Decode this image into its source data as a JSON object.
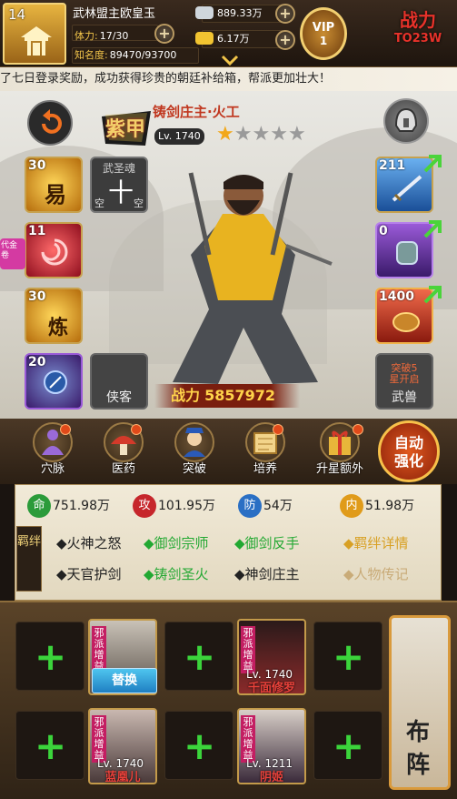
{
  "player": {
    "level": "14",
    "name": "武林盟主欧皇玉",
    "stamina_label": "体力:",
    "stamina": "17/30",
    "fame_label": "知名度:",
    "fame": "89470/93700"
  },
  "currency": {
    "silver": "889.33万",
    "gold": "6.17万"
  },
  "vip": {
    "label": "VIP",
    "level": "1"
  },
  "logo": {
    "text": "战力",
    "sub": "TO23W"
  },
  "marquee": "了七日登录奖励，成功获得珍贵的朝廷补给箱，帮派更加壮大！",
  "hero": {
    "title_badge": "紫甲",
    "name": "铸剑庄主·火工",
    "level": "Lv. 1740",
    "stars_filled": 1,
    "stars_total": 5,
    "power_label": "战力",
    "power": "5857972"
  },
  "left_slots": [
    {
      "num": "30",
      "glyph": "易",
      "color": "#e8a51e"
    },
    {
      "num": "",
      "glyph": "十",
      "top": "武圣魂",
      "corner_l": "空",
      "corner_r": "空",
      "color": "#555"
    },
    {
      "num": "11",
      "glyph": "",
      "color": "#d0283c"
    },
    {
      "num": "30",
      "glyph": "炼",
      "color": "#e8a51e"
    },
    {
      "num": "20",
      "glyph": "",
      "color": "#8a3ac4"
    },
    {
      "num": "",
      "glyph": "",
      "cap": "侠客",
      "color": "#555"
    }
  ],
  "side_tag": "代金卷",
  "right_slots": [
    {
      "num": "211",
      "color": "#3a79c9"
    },
    {
      "num": "0",
      "color": "#8a3ac4"
    },
    {
      "num": "1400",
      "color": "#d0283c"
    },
    {
      "num": "",
      "top": "突破5",
      "top2": "星开启",
      "cap": "武兽",
      "color": "#555"
    }
  ],
  "actions": [
    {
      "label": "穴脉"
    },
    {
      "label": "医药"
    },
    {
      "label": "突破"
    },
    {
      "label": "培养"
    },
    {
      "label": "升星额外"
    }
  ],
  "auto_button": {
    "line1": "自动",
    "line2": "强化"
  },
  "stats": [
    {
      "badge": "命",
      "value": "751.98万",
      "color": "#2b9b3a"
    },
    {
      "badge": "攻",
      "value": "101.95万",
      "color": "#c6262b"
    },
    {
      "badge": "防",
      "value": "54万",
      "color": "#2a6fc4"
    },
    {
      "badge": "内",
      "value": "51.98万",
      "color": "#e09b1a"
    }
  ],
  "bond_title": "羁绊",
  "bonds": [
    {
      "text": "◆火神之怒",
      "active": false
    },
    {
      "text": "◆御剑宗师",
      "active": true
    },
    {
      "text": "◆御剑反手",
      "active": true
    },
    {
      "text": "◆天官护剑",
      "active": false
    },
    {
      "text": "◆铸剑圣火",
      "active": true
    },
    {
      "text": "◆神剑庄主",
      "active": false
    }
  ],
  "links": {
    "bond_detail": "◆羁绊详情",
    "bio": "◆人物传记"
  },
  "formation": {
    "tag": "邪派增益",
    "swap_label": "替换",
    "lineup_label1": "布",
    "lineup_label2": "阵",
    "heroes": [
      {
        "level": "Lv. 1740",
        "name": "千面修罗"
      },
      {
        "level": "Lv. 1740",
        "name": "蓝凰儿"
      },
      {
        "level": "Lv. 1211",
        "name": "阴姬"
      }
    ]
  }
}
